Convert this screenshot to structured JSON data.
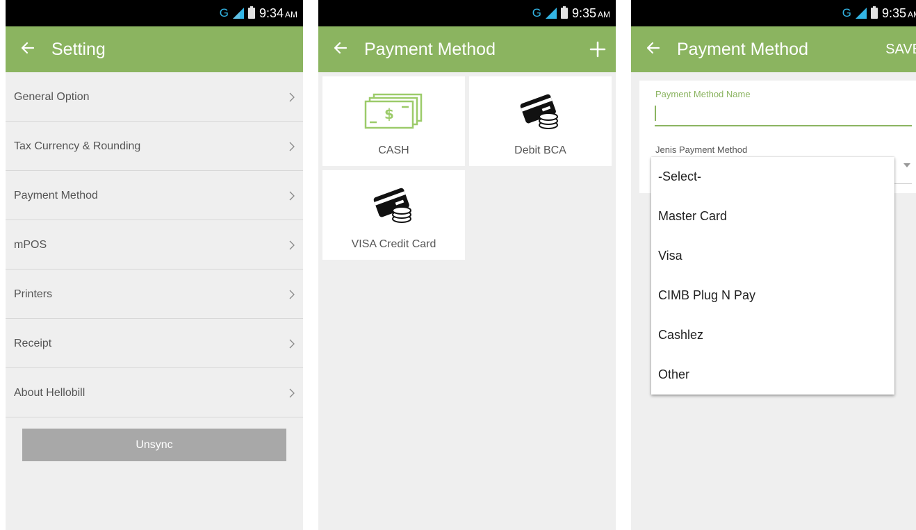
{
  "colors": {
    "accent": "#8bb460",
    "status_bar": "#000000",
    "network_blue": "#33b5e5",
    "background": "#efefef"
  },
  "screen1": {
    "status": {
      "network": "G",
      "time": "9:34",
      "ampm": "AM"
    },
    "title": "Setting",
    "menu": [
      {
        "label": "General Option"
      },
      {
        "label": "Tax Currency & Rounding"
      },
      {
        "label": "Payment Method"
      },
      {
        "label": "mPOS"
      },
      {
        "label": "Printers"
      },
      {
        "label": "Receipt"
      },
      {
        "label": "About Hellobill"
      }
    ],
    "unsync_label": "Unsync"
  },
  "screen2": {
    "status": {
      "network": "G",
      "time": "9:35",
      "ampm": "AM"
    },
    "title": "Payment Method",
    "methods": [
      {
        "label": "CASH",
        "icon": "cash-icon"
      },
      {
        "label": "Debit BCA",
        "icon": "card-coins-icon"
      },
      {
        "label": "VISA Credit Card",
        "icon": "card-coins-icon"
      }
    ]
  },
  "screen3": {
    "status": {
      "network": "G",
      "time": "9:35",
      "ampm": "AM"
    },
    "title": "Payment Method",
    "save_label": "SAVE",
    "name_label": "Payment Method Name",
    "name_value": "",
    "jenis_label": "Jenis Payment Method",
    "options": [
      "-Select-",
      "Master Card",
      "Visa",
      "CIMB Plug N Pay",
      "Cashlez",
      "Other"
    ]
  }
}
